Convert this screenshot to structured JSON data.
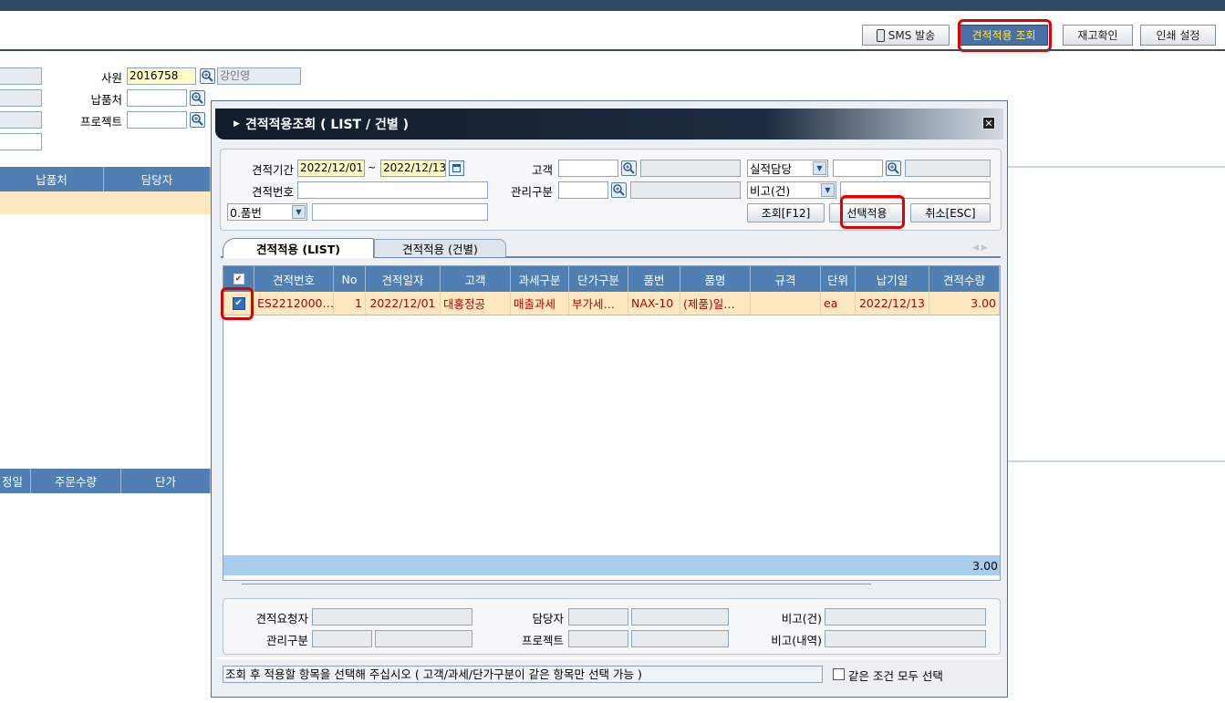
{
  "toolbar": {
    "sms_label": "SMS 발송",
    "quote_label": "견적적용 조회",
    "stock_label": "재고확인",
    "print_label": "인쇄 설정"
  },
  "bg_form": {
    "employee_label": "사원",
    "employee_code": "2016758",
    "employee_name": "강인영",
    "delivery_label": "납품처",
    "project_label": "프로젝트"
  },
  "bg_grid1": {
    "headers": [
      "납품처",
      "담당자"
    ]
  },
  "bg_grid2": {
    "headers": [
      "정일",
      "주문수량",
      "단가"
    ]
  },
  "dialog": {
    "title": "견적적용조회 ( LIST / 건별 )",
    "filters": {
      "period_label": "견적기간",
      "period_from": "2022/12/01",
      "period_sep": "~",
      "period_to": "2022/12/13",
      "quote_no_label": "견적번호",
      "customer_label": "고객",
      "mgmt_label": "관리구분",
      "sales_rep_label": "실적담당",
      "remark_label": "비고(건)",
      "item_select": "0.품번"
    },
    "buttons": {
      "search": "조회[F12]",
      "apply": "선택적용",
      "cancel": "취소[ESC]"
    },
    "tabs": [
      "견적적용 (LIST)",
      "견적적용 (건별)"
    ],
    "grid": {
      "headers": [
        "견적번호",
        "No",
        "견적일자",
        "고객",
        "과세구분",
        "단가구분",
        "품번",
        "품명",
        "규격",
        "단위",
        "납기일",
        "견적수량"
      ],
      "rows": [
        [
          "ES2212000…",
          "1",
          "2022/12/01",
          "대홍정공",
          "매출과세",
          "부가세…",
          "NAX-10",
          "(제품)일…",
          "",
          "ea",
          "2022/12/13",
          "3.00"
        ]
      ],
      "total": "3.00"
    },
    "footer_form": {
      "requester_label": "견적요청자",
      "manager_label": "담당자",
      "remark_label": "비고(건)",
      "mgmt_label": "관리구분",
      "project_label": "프로젝트",
      "remark_detail_label": "비고(내역)"
    },
    "status": "조회 후 적용할 항목을 선택해 주십시오 ( 고객/과세/단가구분이 같은 항목만 선택 가능 )",
    "same_cond_label": "같은 조건 모두 선택"
  }
}
